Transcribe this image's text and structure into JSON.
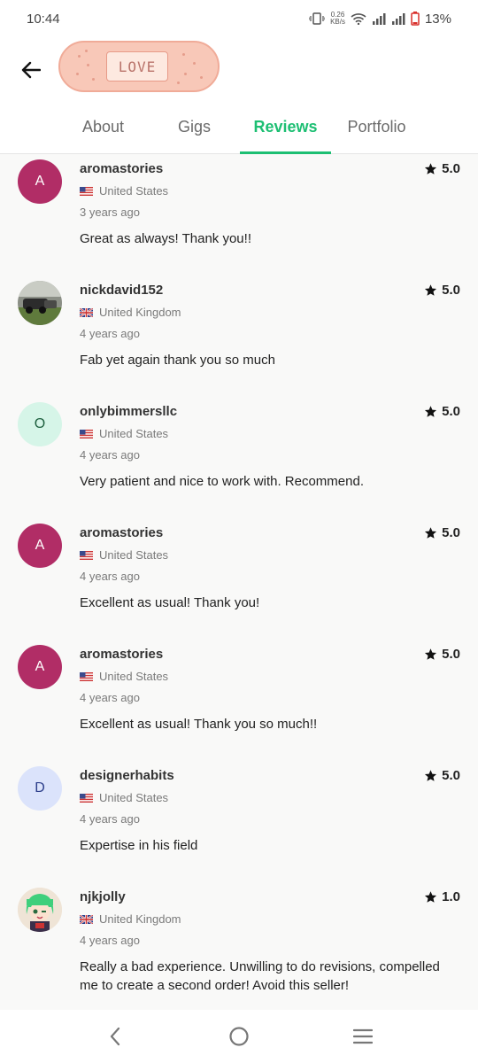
{
  "status_bar": {
    "time": "10:44",
    "net_speed_value": "0.26",
    "net_speed_unit": "KB/s",
    "battery": "13%"
  },
  "header": {
    "back_icon": "arrow-left-icon",
    "sticker_text": "LOVE"
  },
  "tabs": [
    {
      "label": "About",
      "active": false
    },
    {
      "label": "Gigs",
      "active": false
    },
    {
      "label": "Reviews",
      "active": true
    },
    {
      "label": "Portfolio",
      "active": false
    }
  ],
  "colors": {
    "accent": "#1dbf73",
    "avatar_a": "#b12d66",
    "avatar_o_bg": "#d6f5e8",
    "avatar_d_bg": "#dbe3fb"
  },
  "reviews": [
    {
      "avatar_letter": "A",
      "username": "aromastories",
      "country": "United States",
      "time": "3 years ago",
      "rating": "5.0",
      "text": "Great as always! Thank you!!"
    },
    {
      "avatar_letter": "",
      "username": "nickdavid152",
      "country": "United Kingdom",
      "time": "4 years ago",
      "rating": "5.0",
      "text": "Fab yet again thank you so much"
    },
    {
      "avatar_letter": "O",
      "username": "onlybimmersllc",
      "country": "United States",
      "time": "4 years ago",
      "rating": "5.0",
      "text": "Very patient and nice to work with. Recommend."
    },
    {
      "avatar_letter": "A",
      "username": "aromastories",
      "country": "United States",
      "time": "4 years ago",
      "rating": "5.0",
      "text": "Excellent as usual! Thank you!"
    },
    {
      "avatar_letter": "A",
      "username": "aromastories",
      "country": "United States",
      "time": "4 years ago",
      "rating": "5.0",
      "text": "Excellent as usual! Thank you so much!!"
    },
    {
      "avatar_letter": "D",
      "username": "designerhabits",
      "country": "United States",
      "time": "4 years ago",
      "rating": "5.0",
      "text": "Expertise in his field"
    },
    {
      "avatar_letter": "",
      "username": "njkjolly",
      "country": "United Kingdom",
      "time": "4 years ago",
      "rating": "1.0",
      "text": "Really a bad experience. Unwilling to do revisions, compelled me to create a second order! Avoid this seller!"
    }
  ]
}
